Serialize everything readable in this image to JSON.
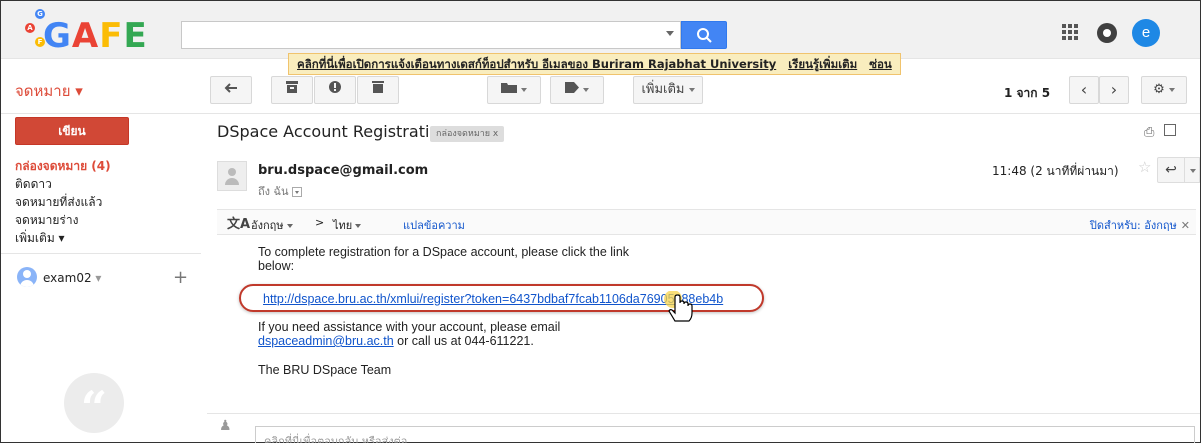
{
  "header": {
    "logo": "GAFE",
    "search_placeholder": "",
    "avatar_letter": "e",
    "banner": {
      "text": "คลิกที่นี่เพื่อเปิดการแจ้งเตือนทางเดสก์ท็อปสำหรับ อีเมลของ Buriram Rajabhat University",
      "learn_more": "เรียนรู้เพิ่มเติม",
      "hide": "ซ่อน"
    }
  },
  "toolbar": {
    "mail_label": "จดหมาย ▾",
    "more_label": "เพิ่มเติม",
    "pager_range": "1 จาก 5"
  },
  "sidebar": {
    "compose": "เขียน",
    "items": [
      {
        "label": "กล่องจดหมาย (4)"
      },
      {
        "label": "ติดดาว"
      },
      {
        "label": "จดหมายที่ส่งแล้ว"
      },
      {
        "label": "จดหมายร่าง"
      },
      {
        "label": "เพิ่มเติม ▾"
      }
    ],
    "account": "exam02"
  },
  "message": {
    "subject": "DSpace Account Registration",
    "label_chip": "กล่องจดหมาย   x",
    "sender": "bru.dspace@gmail.com",
    "to_me": "ถึง ฉัน",
    "timestamp": "11:48 (2 นาทีที่ผ่านมา)",
    "translate": {
      "from_lang": "อังกฤษ",
      "to_lang": "ไทย",
      "action": "แปลข้อความ",
      "disable": "ปิดสำหรับ: อังกฤษ"
    },
    "body": {
      "line1": "To complete registration for a DSpace account, please click the link",
      "line2": "below:",
      "register_link": "http://dspace.bru.ac.th/xmlui/register?token=6437bdbaf7fcab1106da76905488eb4b",
      "assist_line": "If you need assistance with your account, please email",
      "email_link": "dspaceadmin@bru.ac.th",
      "call_text": " or call us at 044-611221.",
      "signature": "The BRU DSpace Team"
    },
    "reply_placeholder": "คลิกที่นี่เพื่อตอบกลับ หรือส่งต่อ"
  },
  "colors": {
    "brand_red": "#dd4b39",
    "compose_bg": "#d14836",
    "search_blue": "#4285f4",
    "link": "#1155cc",
    "banner_bg": "#f9edbe",
    "highlight_ring": "#c0392b"
  }
}
